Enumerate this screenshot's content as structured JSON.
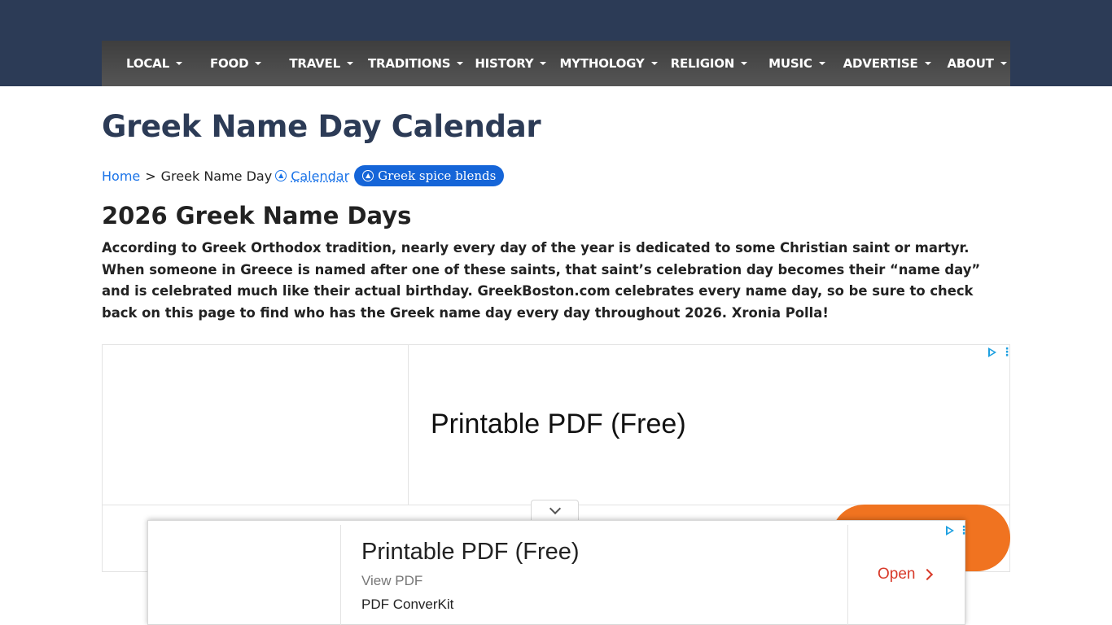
{
  "nav": {
    "items": [
      {
        "label": "LOCAL"
      },
      {
        "label": "FOOD"
      },
      {
        "label": "TRAVEL"
      },
      {
        "label": "TRADITIONS"
      },
      {
        "label": "HISTORY"
      },
      {
        "label": "MYTHOLOGY"
      },
      {
        "label": "RELIGION"
      },
      {
        "label": "MUSIC"
      },
      {
        "label": "ADVERTISE"
      },
      {
        "label": "ABOUT"
      }
    ]
  },
  "page": {
    "title": "Greek Name Day Calendar",
    "section_heading": "2026 Greek Name Days",
    "intro": "According to Greek Orthodox tradition, nearly every day of the year is dedicated to some Christian saint or martyr. When someone in Greece is named after one of these saints, that saint’s celebration day becomes their “name day” and is celebrated much like their actual birthday. GreekBoston.com celebrates every name day, so be sure to check back on this page to find who has the Greek name day every day throughout 2026. Xronia Polla!"
  },
  "breadcrumb": {
    "home": "Home",
    "separator": ">",
    "current": "Greek Name Day",
    "calendar_link": "Calendar",
    "pill_label": "Greek spice blends"
  },
  "ad": {
    "headline": "Printable PDF (Free)",
    "accent_color": "#f07320"
  },
  "sticky_ad": {
    "headline": "Printable PDF (Free)",
    "subtitle": "View PDF",
    "brand": "PDF ConverKit",
    "cta": "Open",
    "cta_color": "#d83a2a"
  },
  "colors": {
    "header_bg": "#2c3b56",
    "link": "#1a73e8",
    "pill_bg": "#1565d8"
  }
}
